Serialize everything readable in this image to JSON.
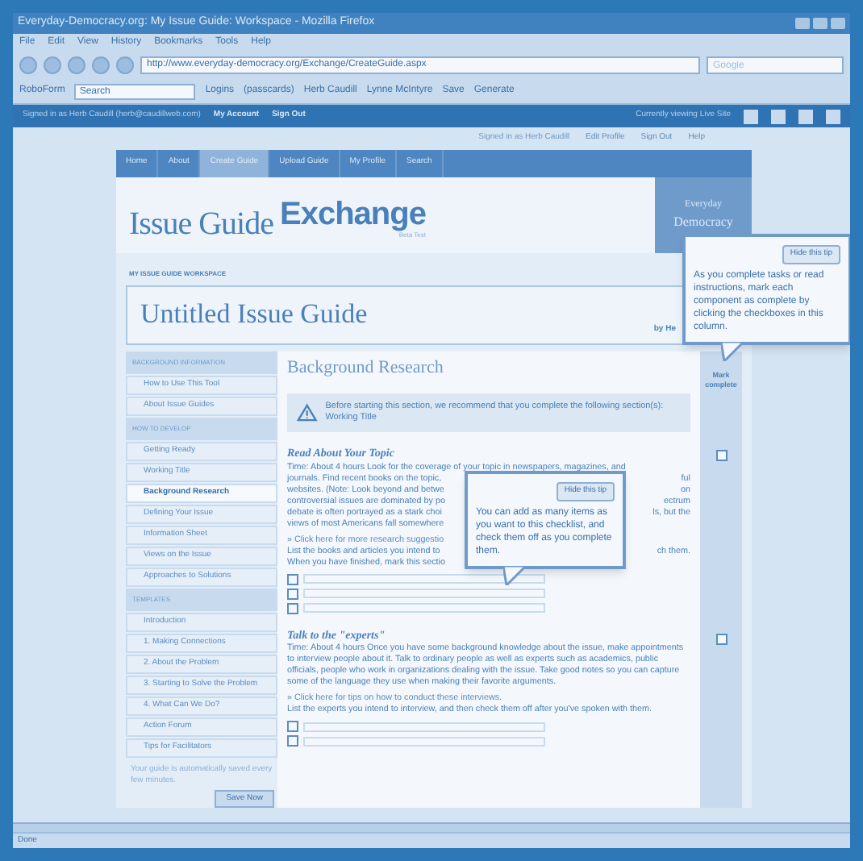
{
  "window": {
    "title": "Everyday-Democracy.org: My Issue Guide: Workspace - Mozilla Firefox"
  },
  "menu": [
    "File",
    "Edit",
    "View",
    "History",
    "Bookmarks",
    "Tools",
    "Help"
  ],
  "address": {
    "value": "http://www.everyday-democracy.org/Exchange/CreateGuide.aspx"
  },
  "search": {
    "placeholder": "Google"
  },
  "toolbar": {
    "brand": "RoboForm",
    "search_placeholder": "Search",
    "items": [
      "Logins",
      "(passcards)",
      "Herb Caudill",
      "Lynne McIntyre",
      "Save",
      "Generate"
    ]
  },
  "site_bar": {
    "signed_in": "Signed in as Herb Caudill (herb@caudillweb.com)",
    "links": [
      "My Account",
      "Sign Out"
    ],
    "viewing": "Currently viewing Live Site"
  },
  "top_links": {
    "signed_in": "Signed in as Herb Caudill",
    "links": [
      "Edit Profile",
      "Sign Out",
      "Help"
    ]
  },
  "nav": [
    {
      "label": "Home",
      "selected": false
    },
    {
      "label": "About",
      "selected": false
    },
    {
      "label": "Create Guide",
      "selected": true
    },
    {
      "label": "Upload Guide",
      "selected": false
    },
    {
      "label": "My Profile",
      "selected": false
    },
    {
      "label": "Search",
      "selected": false
    }
  ],
  "logo": {
    "first": "Issue Guide",
    "second": "Exchange",
    "tag": "Beta Test",
    "org_top": "Everyday",
    "org_bottom": "Democracy"
  },
  "workspace_label": "MY ISSUE GUIDE WORKSPACE",
  "guide_title": "Untitled Issue Guide",
  "byline": "by He",
  "sidebar": [
    {
      "heading": "BACKGROUND INFORMATION",
      "items": [
        {
          "label": "How to Use This Tool",
          "selected": false
        },
        {
          "label": "About Issue Guides",
          "selected": false
        }
      ]
    },
    {
      "heading": "HOW TO DEVELOP",
      "items": [
        {
          "label": "Getting Ready",
          "selected": false
        },
        {
          "label": "Working Title",
          "selected": false
        },
        {
          "label": "Background Research",
          "selected": true
        },
        {
          "label": "Defining Your Issue",
          "selected": false
        },
        {
          "label": "Information Sheet",
          "selected": false
        },
        {
          "label": "Views on the Issue",
          "selected": false
        },
        {
          "label": "Approaches to Solutions",
          "selected": false
        }
      ]
    },
    {
      "heading": "TEMPLATES",
      "items": [
        {
          "label": "Introduction",
          "selected": false
        },
        {
          "label": "1. Making Connections",
          "selected": false
        },
        {
          "label": "2. About the Problem",
          "selected": false
        },
        {
          "label": "3. Starting to Solve the Problem",
          "selected": false
        },
        {
          "label": "4. What Can We Do?",
          "selected": false
        },
        {
          "label": "Action Forum",
          "selected": false
        },
        {
          "label": "Tips for Facilitators",
          "selected": false
        }
      ]
    }
  ],
  "autosave_note": "Your guide is automatically saved every few minutes.",
  "save_button": "Save Now",
  "section_title": "Background Research",
  "warning": "Before starting this section, we recommend that you complete the following section(s): Working Title",
  "mark_column": {
    "label": "Mark complete",
    "boxes": [
      {
        "checked": false
      },
      {
        "checked": false
      }
    ]
  },
  "tasks": [
    {
      "heading": "Read About Your Topic",
      "lines": [
        {
          "left": "Time: About 4 hours Look for the coverage of your topic in newspapers, magazines, and"
        },
        {
          "left": "journals. Find recent books on the topic,",
          "right": "ful"
        },
        {
          "left": "websites. (Note: Look beyond and betwe",
          "right": "on"
        },
        {
          "left": "controversial issues are dominated by po",
          "right": "ectrum"
        },
        {
          "left": "debate is often portrayed as a stark choi",
          "right": "ls, but the"
        },
        {
          "left": "views of most Americans fall somewhere"
        }
      ],
      "link": "» Click here for more research suggestio",
      "instruction": [
        {
          "left": "List the books and articles you intend to",
          "right": "ch them."
        },
        {
          "left": "When you have finished, mark this sectio"
        }
      ],
      "checklist": [
        {
          "checked": false
        },
        {
          "checked": false
        },
        {
          "checked": false
        }
      ],
      "tip": {
        "button": "Hide this tip",
        "text": "You can add as many items as you want to this checklist, and check them off as you complete them."
      }
    },
    {
      "heading": "Talk to the \"experts\"",
      "lines": [
        {
          "left": "Time: About 4 hours Once you have some background knowledge about the issue, make appointments to interview people about it. Talk to ordinary people as well as experts such as academics, public officials, people who work in organizations dealing with the issue. Take good notes so you can capture some of the language they use when making their favorite arguments."
        }
      ],
      "link": "» Click here for tips on how to conduct these interviews.",
      "instruction": [
        {
          "left": "List the experts you intend to interview, and then check them off after you've spoken with them."
        }
      ],
      "checklist": [
        {
          "checked": false
        },
        {
          "checked": false
        }
      ]
    }
  ],
  "column_tip": {
    "button": "Hide this tip",
    "text": "As you complete tasks or read instructions, mark each component as complete by clicking the checkboxes in this column."
  },
  "status": "Done"
}
